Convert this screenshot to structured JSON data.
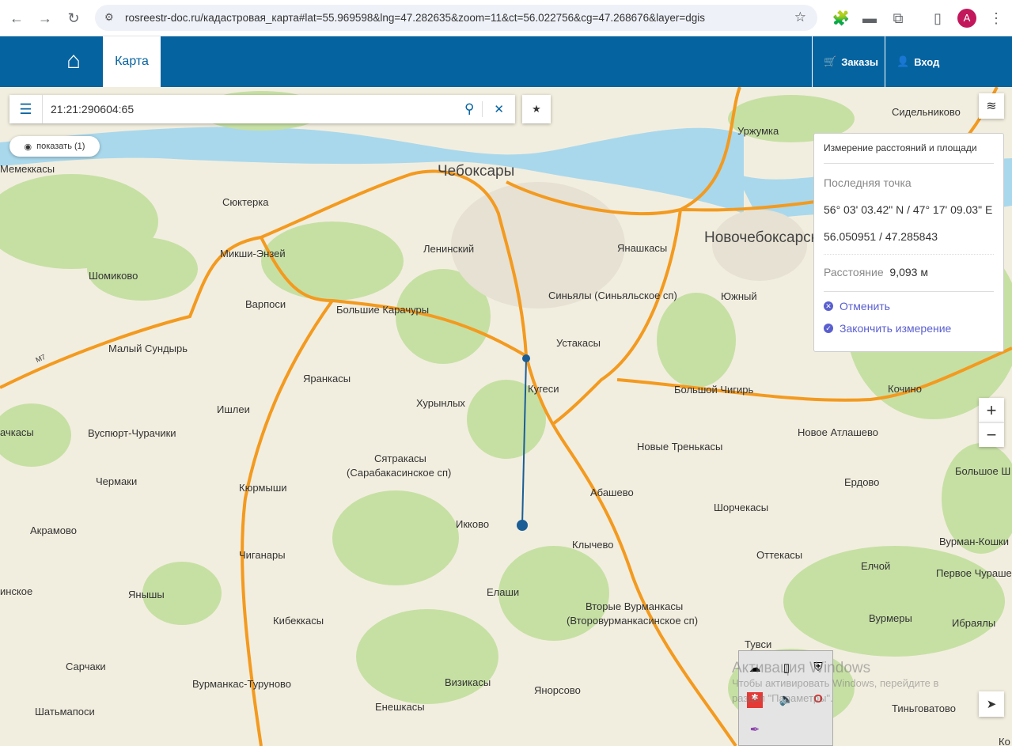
{
  "browser": {
    "url": "rosreestr-doc.ru/кадастровая_карта#lat=55.969598&lng=47.282635&zoom=11&ct=56.022756&cg=47.268676&layer=dgis",
    "profile_initial": "A"
  },
  "header": {
    "tab_map": "Карта",
    "orders": "Заказы",
    "login": "Вход"
  },
  "search": {
    "value": "21:21:290604:65"
  },
  "show_button": "показать (1)",
  "measure": {
    "title": "Измерение расстояний и площади",
    "last_point_label": "Последняя точка",
    "dms": "56° 03' 03.42\" N / 47° 17' 09.03\" E",
    "decimal": "56.050951 / 47.285843",
    "distance_label": "Расстояние",
    "distance_value": "9,093 м",
    "cancel": "Отменить",
    "finish": "Закончить измерение"
  },
  "zoom": {
    "in": "+",
    "out": "−"
  },
  "watermark": {
    "title": "Активация Windows",
    "text1": "Чтобы активировать Windows, перейдите в",
    "text2": "раздел \"Параметры\"."
  },
  "map_labels": [
    "Чебоксары",
    "Новочебоксарск",
    "Сидельниково",
    "Уржумка",
    "Мемеккасы",
    "Сюктерка",
    "Микши-Энзей",
    "Шомиково",
    "Ленинский",
    "Янашкасы",
    "Варпоси",
    "Большие Карачуры",
    "Синьялы (Синьяльское сп)",
    "Южный",
    "Малый Сундырь",
    "Устакасы",
    "Яранкасы",
    "Кугеси",
    "Большой Чигирь",
    "Кочино",
    "Ишлеи",
    "Хурынлых",
    "Вуспюрт-Чурачики",
    "Новое Атлашево",
    "Новые Тренькасы",
    "Сятракасы",
    "(Сарабакасинское сп)",
    "Чермаки",
    "Ердово",
    "Кюрмыши",
    "Абашево",
    "Большое Ш",
    "Шорчекасы",
    "Акрамово",
    "Икково",
    "Вурман-Кошки",
    "Клычево",
    "Чиганары",
    "Оттекасы",
    "Елчой",
    "Первое Чураше",
    "Янышы",
    "Елаши",
    "Вторые Вурманкасы",
    "(Второвурманкасинское сп)",
    "Кибеккасы",
    "Вурмеры",
    "Ибраялы",
    "Тувси",
    "Сарчаки",
    "Визикасы",
    "Вурманкас-Туруново",
    "Янорсово",
    "Енешкасы",
    "Тиньговатово",
    "Шатьмапоси",
    "М7",
    "ачкасы",
    "инское",
    "Ко"
  ]
}
